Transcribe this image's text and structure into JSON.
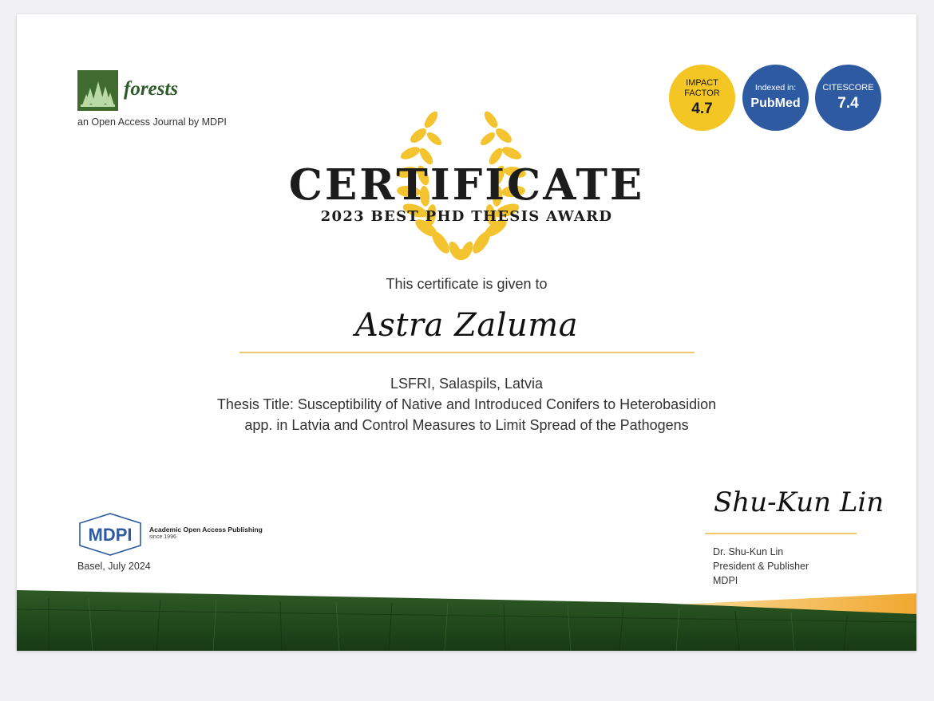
{
  "journal": {
    "name": "forests",
    "subtitle": "an Open Access Journal by MDPI"
  },
  "badges": {
    "impact_factor": {
      "label": "IMPACT FACTOR",
      "label_line1": "IMPACT",
      "label_line2": "FACTOR",
      "value": "4.7",
      "color": "#f4c623"
    },
    "indexed": {
      "label": "Indexed in:",
      "value": "PubMed",
      "color": "#2d5aa0"
    },
    "citescore": {
      "label": "CITESCORE",
      "value": "7.4",
      "color": "#2d5aa0"
    }
  },
  "certificate": {
    "title": "CERTIFICATE",
    "subtitle": "2023 BEST PHD THESIS AWARD",
    "given_to": "This certificate is given to",
    "recipient": "Astra Zaluma",
    "affiliation": "LSFRI, Salaspils, Latvia",
    "thesis_line1": "Thesis Title: Susceptibility of Native and Introduced Conifers to Heterobasidion",
    "thesis_line2": "app. in Latvia and Control Measures to Limit Spread of the Pathogens"
  },
  "publisher": {
    "logo_text": "MDPI",
    "tagline": "Academic Open Access Publishing",
    "since": "since 1996",
    "place_date": "Basel, July 2024"
  },
  "signatory": {
    "signature": "Shu-Kun Lin",
    "name": "Dr. Shu-Kun Lin",
    "title": "President & Publisher",
    "org": "MDPI"
  },
  "colors": {
    "accent_gold": "#f2c76a",
    "laurel_gold": "#f4c430",
    "forest_green": "#2f5a2a",
    "orange": "#f0a830"
  }
}
